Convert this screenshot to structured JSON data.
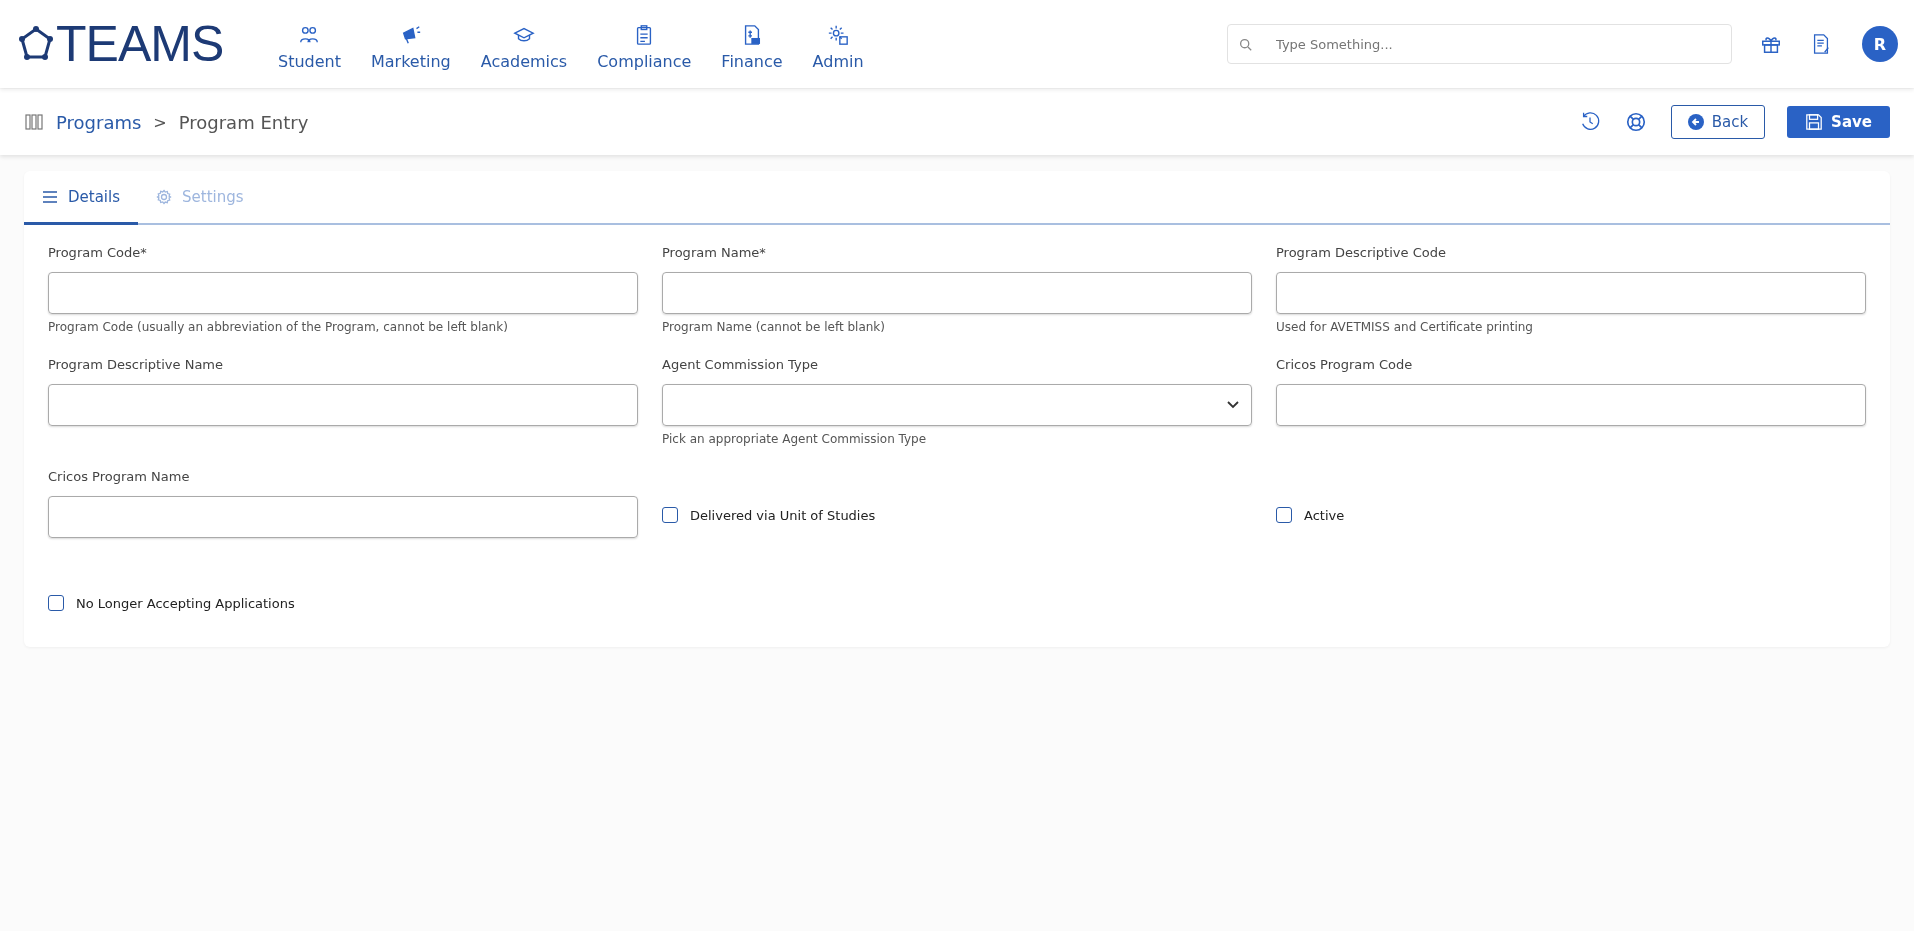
{
  "logo": "TEAMS",
  "nav": [
    {
      "label": "Student"
    },
    {
      "label": "Marketing"
    },
    {
      "label": "Academics"
    },
    {
      "label": "Compliance"
    },
    {
      "label": "Finance"
    },
    {
      "label": "Admin"
    }
  ],
  "search": {
    "placeholder": "Type Something..."
  },
  "avatar": "R",
  "breadcrumb": {
    "parent": "Programs",
    "separator": ">",
    "current": "Program Entry"
  },
  "actions": {
    "back": "Back",
    "save": "Save"
  },
  "tabs": [
    {
      "label": "Details",
      "selected": true
    },
    {
      "label": "Settings",
      "selected": false
    }
  ],
  "fields": [
    {
      "kind": "text",
      "label": "Program Code*",
      "hint": "Program Code (usually an abbreviation of the Program, cannot be left blank)"
    },
    {
      "kind": "text",
      "label": "Program Name*",
      "hint": "Program Name (cannot be left blank)"
    },
    {
      "kind": "text",
      "label": "Program Descriptive Code",
      "hint": "Used for AVETMISS and Certificate printing"
    },
    {
      "kind": "text",
      "label": "Program Descriptive Name"
    },
    {
      "kind": "select",
      "label": "Agent Commission Type",
      "hint": "Pick an appropriate Agent Commission Type"
    },
    {
      "kind": "text",
      "label": "Cricos Program Code"
    },
    {
      "kind": "text",
      "label": "Cricos Program Name"
    },
    {
      "kind": "checkbox",
      "label": "Delivered via Unit of Studies",
      "checked": false
    },
    {
      "kind": "checkbox",
      "label": "Active",
      "checked": false
    },
    {
      "kind": "checkbox",
      "label": "No Longer Accepting Applications",
      "checked": false
    }
  ]
}
